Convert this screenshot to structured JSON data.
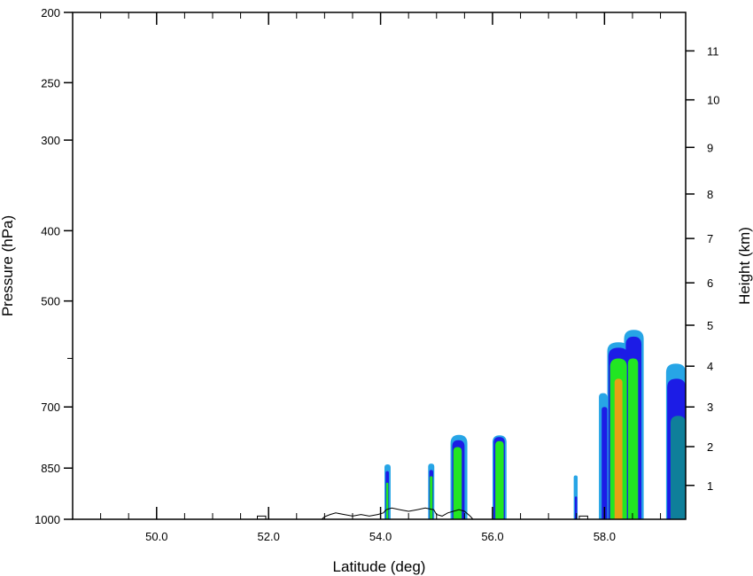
{
  "chart_data": {
    "type": "heatmap",
    "title": "",
    "xlabel": "Latitude (deg)",
    "ylabel": "Pressure (hPa)",
    "y2label": "Height (km)",
    "xlim": [
      48.5,
      59.45
    ],
    "ylim": [
      1000,
      200
    ],
    "yscale": "log",
    "x_ticks": [
      {
        "value": 50.0,
        "label": "50.0"
      },
      {
        "value": 52.0,
        "label": "52.0"
      },
      {
        "value": 54.0,
        "label": "54.0"
      },
      {
        "value": 56.0,
        "label": "56.0"
      },
      {
        "value": 58.0,
        "label": "58.0"
      }
    ],
    "x_minor_step": 0.5,
    "y_ticks": [
      {
        "value": 200,
        "label": "200"
      },
      {
        "value": 250,
        "label": "250"
      },
      {
        "value": 300,
        "label": "300"
      },
      {
        "value": 400,
        "label": "400"
      },
      {
        "value": 500,
        "label": "500"
      },
      {
        "value": 700,
        "label": "700"
      },
      {
        "value": 850,
        "label": "850"
      },
      {
        "value": 1000,
        "label": "1000"
      }
    ],
    "y_minor": [
      600
    ],
    "y2_ticks": [
      {
        "value": 1,
        "label": "1",
        "p": 898
      },
      {
        "value": 2,
        "label": "2",
        "p": 794
      },
      {
        "value": 3,
        "label": "3",
        "p": 700
      },
      {
        "value": 4,
        "label": "4",
        "p": 615
      },
      {
        "value": 5,
        "label": "5",
        "p": 540
      },
      {
        "value": 6,
        "label": "6",
        "p": 472
      },
      {
        "value": 7,
        "label": "7",
        "p": 410
      },
      {
        "value": 8,
        "label": "8",
        "p": 356
      },
      {
        "value": 9,
        "label": "9",
        "p": 307
      },
      {
        "value": 10,
        "label": "10",
        "p": 264
      },
      {
        "value": 11,
        "label": "11",
        "p": 226
      }
    ],
    "grid": false,
    "colors": {
      "level1": "#27a5e6",
      "level2": "#1c1ce6",
      "level3": "#0f7f9a",
      "level4": "#22e622",
      "level5": "#e6a016",
      "terrain": "#000000"
    },
    "cells": [
      {
        "lat_min": 54.07,
        "lat_max": 54.18,
        "p_top": 840,
        "level": 1
      },
      {
        "lat_min": 54.09,
        "lat_max": 54.15,
        "p_top": 858,
        "level": 2
      },
      {
        "lat_min": 54.1,
        "lat_max": 54.14,
        "p_top": 890,
        "level": 4
      },
      {
        "lat_min": 54.85,
        "lat_max": 54.96,
        "p_top": 838,
        "level": 1
      },
      {
        "lat_min": 54.87,
        "lat_max": 54.94,
        "p_top": 855,
        "level": 2
      },
      {
        "lat_min": 54.88,
        "lat_max": 54.93,
        "p_top": 872,
        "level": 4
      },
      {
        "lat_min": 55.25,
        "lat_max": 55.55,
        "p_top": 765,
        "level": 1
      },
      {
        "lat_min": 55.28,
        "lat_max": 55.5,
        "p_top": 778,
        "level": 2
      },
      {
        "lat_min": 55.3,
        "lat_max": 55.45,
        "p_top": 795,
        "level": 4
      },
      {
        "lat_min": 56.0,
        "lat_max": 56.25,
        "p_top": 766,
        "level": 1
      },
      {
        "lat_min": 56.02,
        "lat_max": 56.22,
        "p_top": 770,
        "level": 2
      },
      {
        "lat_min": 56.05,
        "lat_max": 56.2,
        "p_top": 780,
        "level": 4
      },
      {
        "lat_min": 57.45,
        "lat_max": 57.52,
        "p_top": 870,
        "level": 1
      },
      {
        "lat_min": 57.47,
        "lat_max": 57.51,
        "p_top": 930,
        "level": 2
      },
      {
        "lat_min": 57.9,
        "lat_max": 58.05,
        "p_top": 670,
        "level": 1
      },
      {
        "lat_min": 57.95,
        "lat_max": 58.05,
        "p_top": 700,
        "level": 2
      },
      {
        "lat_min": 58.05,
        "lat_max": 58.45,
        "p_top": 570,
        "level": 1
      },
      {
        "lat_min": 58.07,
        "lat_max": 58.43,
        "p_top": 580,
        "level": 2
      },
      {
        "lat_min": 58.1,
        "lat_max": 58.4,
        "p_top": 600,
        "level": 4
      },
      {
        "lat_min": 58.18,
        "lat_max": 58.32,
        "p_top": 640,
        "level": 5
      },
      {
        "lat_min": 58.35,
        "lat_max": 58.7,
        "p_top": 548,
        "level": 1
      },
      {
        "lat_min": 58.38,
        "lat_max": 58.66,
        "p_top": 560,
        "level": 2
      },
      {
        "lat_min": 58.42,
        "lat_max": 58.6,
        "p_top": 600,
        "level": 4
      },
      {
        "lat_min": 59.1,
        "lat_max": 59.45,
        "p_top": 610,
        "level": 1
      },
      {
        "lat_min": 59.12,
        "lat_max": 59.45,
        "p_top": 640,
        "level": 2
      },
      {
        "lat_min": 59.18,
        "lat_max": 59.45,
        "p_top": 720,
        "level": 3
      }
    ],
    "terrain": [
      [
        48.5,
        1000
      ],
      [
        51.8,
        1000
      ],
      [
        51.8,
        990
      ],
      [
        51.95,
        990
      ],
      [
        51.95,
        1000
      ],
      [
        52.95,
        1000
      ],
      [
        53.0,
        992
      ],
      [
        53.1,
        985
      ],
      [
        53.2,
        980
      ],
      [
        53.35,
        985
      ],
      [
        53.5,
        990
      ],
      [
        53.65,
        985
      ],
      [
        53.8,
        990
      ],
      [
        53.95,
        985
      ],
      [
        54.05,
        980
      ],
      [
        54.1,
        970
      ],
      [
        54.2,
        965
      ],
      [
        54.35,
        970
      ],
      [
        54.5,
        975
      ],
      [
        54.65,
        970
      ],
      [
        54.8,
        965
      ],
      [
        54.95,
        970
      ],
      [
        55.0,
        985
      ],
      [
        55.1,
        990
      ],
      [
        55.2,
        980
      ],
      [
        55.3,
        975
      ],
      [
        55.4,
        970
      ],
      [
        55.5,
        975
      ],
      [
        55.6,
        990
      ],
      [
        55.65,
        1000
      ],
      [
        57.55,
        1000
      ],
      [
        57.55,
        990
      ],
      [
        57.7,
        990
      ],
      [
        57.7,
        1000
      ],
      [
        59.45,
        1000
      ]
    ]
  }
}
